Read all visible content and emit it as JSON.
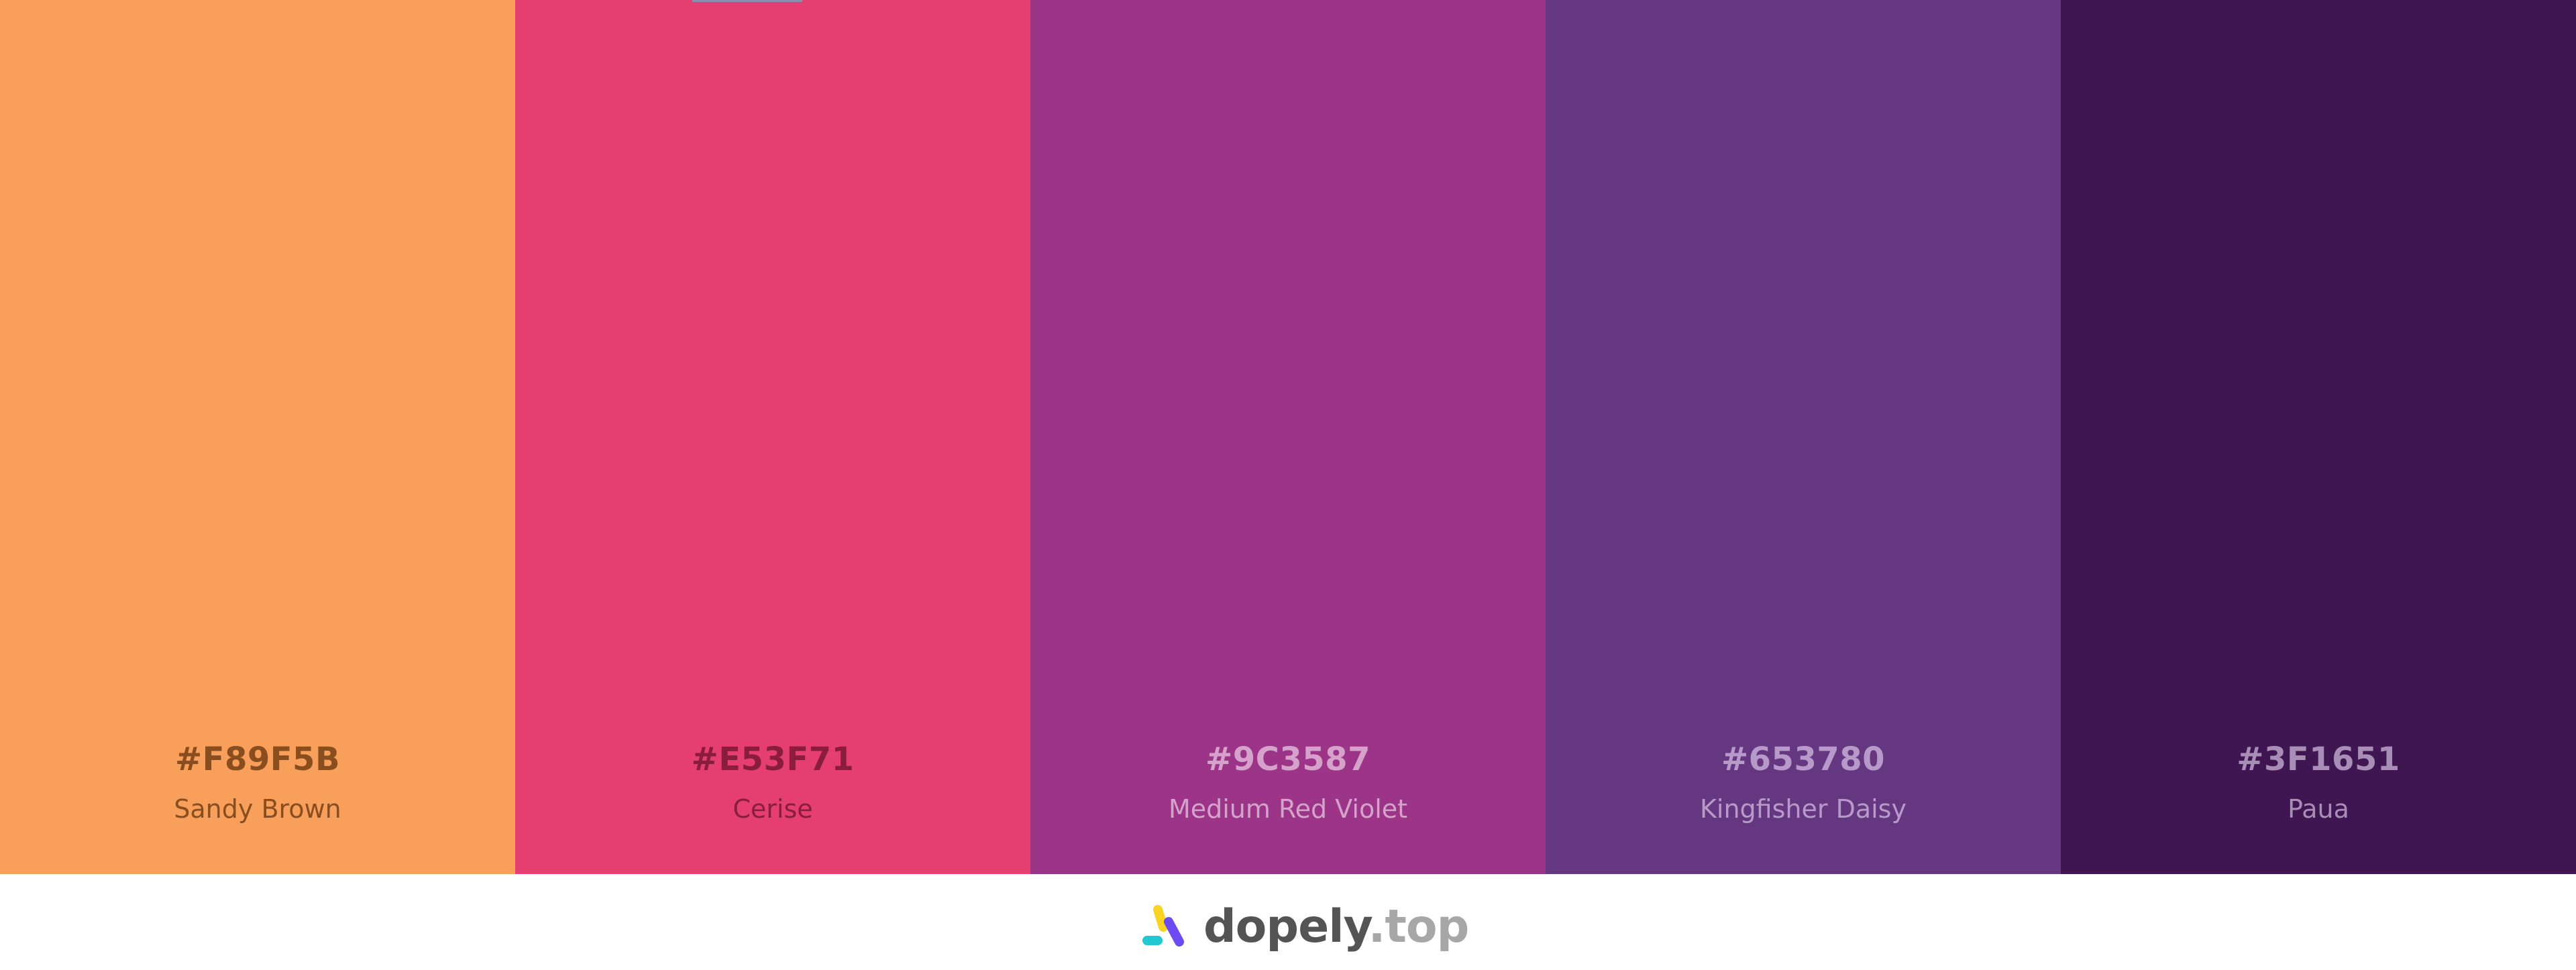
{
  "palette": [
    {
      "hex": "#F89F5B",
      "name": "Sandy Brown",
      "bg": "#F89F5B",
      "text_color": "#8A4E1E"
    },
    {
      "hex": "#E53F71",
      "name": "Cerise",
      "bg": "#E53F71",
      "text_color": "#8A1D3E"
    },
    {
      "hex": "#9C3587",
      "name": "Medium Red Violet",
      "bg": "#9C3587",
      "text_color": "#D6A2CC"
    },
    {
      "hex": "#653780",
      "name": "Kingfisher Daisy",
      "bg": "#653780",
      "text_color": "#B79ACA"
    },
    {
      "hex": "#3F1651",
      "name": "Paua",
      "bg": "#3F1651",
      "text_color": "#A88DB6"
    }
  ],
  "brand": {
    "name": "dopely",
    "tld": ".top",
    "icon": "dopely-logo-icon"
  }
}
